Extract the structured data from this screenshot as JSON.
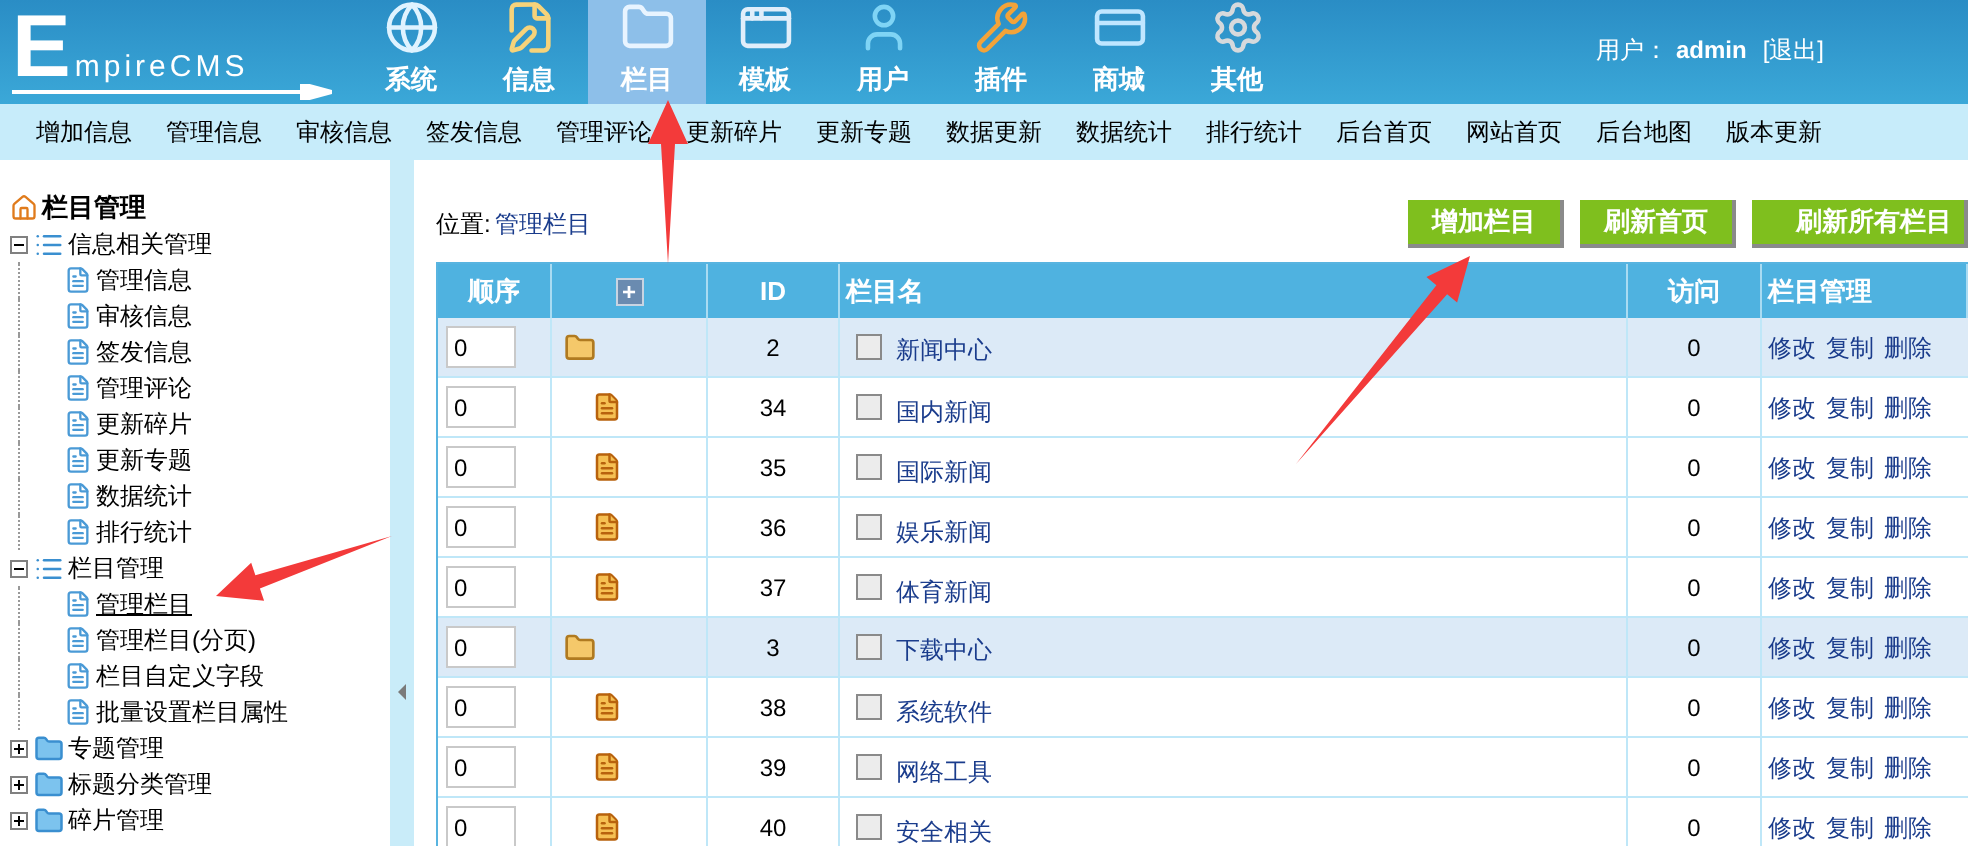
{
  "header": {
    "logo": "EmpireCMS",
    "nav": [
      {
        "label": "系统",
        "selected": false
      },
      {
        "label": "信息",
        "selected": false
      },
      {
        "label": "栏目",
        "selected": true
      },
      {
        "label": "模板",
        "selected": false
      },
      {
        "label": "用户",
        "selected": false
      },
      {
        "label": "插件",
        "selected": false
      },
      {
        "label": "商城",
        "selected": false
      },
      {
        "label": "其他",
        "selected": false
      }
    ],
    "user_label": "用户：",
    "username": "admin",
    "logout": "[退出]"
  },
  "submenu": [
    "增加信息",
    "管理信息",
    "审核信息",
    "签发信息",
    "管理评论",
    "更新碎片",
    "更新专题",
    "数据更新",
    "数据统计",
    "排行统计",
    "后台首页",
    "网站首页",
    "后台地图",
    "版本更新"
  ],
  "sidebar": {
    "title": "栏目管理",
    "tree": [
      {
        "label": "信息相关管理",
        "expanded": true,
        "children": [
          {
            "label": "管理信息",
            "selected": false
          },
          {
            "label": "审核信息",
            "selected": false
          },
          {
            "label": "签发信息",
            "selected": false
          },
          {
            "label": "管理评论",
            "selected": false
          },
          {
            "label": "更新碎片",
            "selected": false
          },
          {
            "label": "更新专题",
            "selected": false
          },
          {
            "label": "数据统计",
            "selected": false
          },
          {
            "label": "排行统计",
            "selected": false
          }
        ]
      },
      {
        "label": "栏目管理",
        "expanded": true,
        "children": [
          {
            "label": "管理栏目",
            "selected": true
          },
          {
            "label": "管理栏目(分页)",
            "selected": false
          },
          {
            "label": "栏目自定义字段",
            "selected": false
          },
          {
            "label": "批量设置栏目属性",
            "selected": false
          }
        ]
      },
      {
        "label": "专题管理",
        "expanded": false
      },
      {
        "label": "标题分类管理",
        "expanded": false
      },
      {
        "label": "碎片管理",
        "expanded": false
      }
    ]
  },
  "location": {
    "label": "位置:",
    "path": "管理栏目"
  },
  "buttons": [
    "增加栏目",
    "刷新首页",
    "刷新所有栏目"
  ],
  "table": {
    "columns": [
      "顺序",
      "+",
      "ID",
      "栏目名",
      "访问",
      "栏目管理"
    ],
    "rows": [
      {
        "kind": "category",
        "order": "0",
        "id": "2",
        "name": "新闻中心",
        "checked": false,
        "visits": "0",
        "actions": [
          "修改",
          "复制",
          "删除"
        ]
      },
      {
        "kind": "item",
        "order": "0",
        "id": "34",
        "name": "国内新闻",
        "checked": false,
        "visits": "0",
        "actions": [
          "修改",
          "复制",
          "删除"
        ]
      },
      {
        "kind": "item",
        "order": "0",
        "id": "35",
        "name": "国际新闻",
        "checked": false,
        "visits": "0",
        "actions": [
          "修改",
          "复制",
          "删除"
        ]
      },
      {
        "kind": "item",
        "order": "0",
        "id": "36",
        "name": "娱乐新闻",
        "checked": false,
        "visits": "0",
        "actions": [
          "修改",
          "复制",
          "删除"
        ]
      },
      {
        "kind": "item",
        "order": "0",
        "id": "37",
        "name": "体育新闻",
        "checked": false,
        "visits": "0",
        "actions": [
          "修改",
          "复制",
          "删除"
        ]
      },
      {
        "kind": "category",
        "order": "0",
        "id": "3",
        "name": "下载中心",
        "checked": false,
        "visits": "0",
        "actions": [
          "修改",
          "复制",
          "删除"
        ]
      },
      {
        "kind": "item",
        "order": "0",
        "id": "38",
        "name": "系统软件",
        "checked": false,
        "visits": "0",
        "actions": [
          "修改",
          "复制",
          "删除"
        ]
      },
      {
        "kind": "item",
        "order": "0",
        "id": "39",
        "name": "网络工具",
        "checked": false,
        "visits": "0",
        "actions": [
          "修改",
          "复制",
          "删除"
        ]
      },
      {
        "kind": "item",
        "order": "0",
        "id": "40",
        "name": "安全相关",
        "checked": false,
        "visits": "0",
        "actions": [
          "修改",
          "复制",
          "删除"
        ]
      }
    ]
  }
}
